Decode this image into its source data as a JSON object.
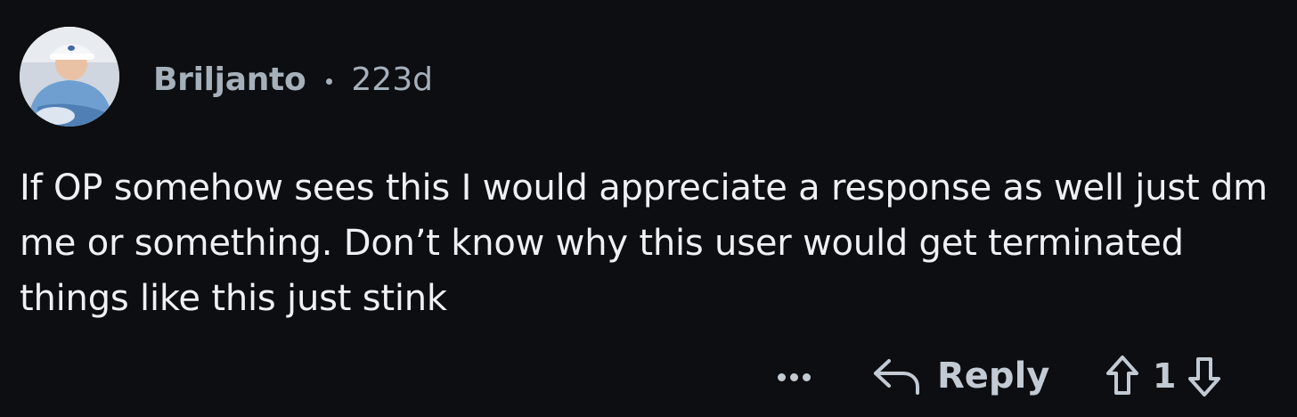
{
  "comment": {
    "author": "Briljanto",
    "age": "223d",
    "body": "If OP somehow sees this I would appreciate a response as well just dm me or something. Don’t know why this user would get terminated things like this just stink"
  },
  "actions": {
    "more_icon": "ellipsis-icon",
    "reply_icon": "reply-arrow-icon",
    "reply_label": "Reply",
    "upvote_icon": "upvote-arrow-icon",
    "vote_count": "1",
    "downvote_icon": "downvote-arrow-icon"
  },
  "colors": {
    "background": "#0c0e11",
    "meta_text": "#a5b0bb",
    "body_text": "#eef1f4",
    "action_text": "#c2cad3"
  }
}
